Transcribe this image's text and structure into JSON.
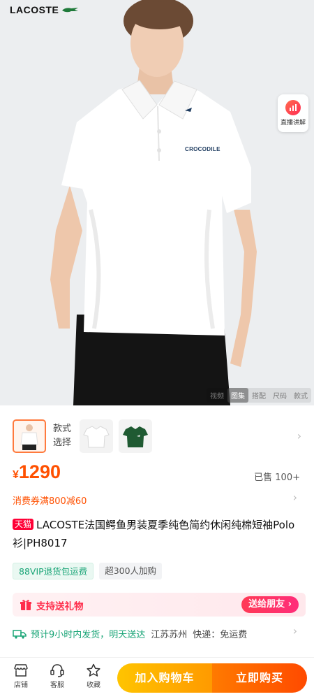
{
  "hero": {
    "brand": "LACOSTE",
    "shirt_print": "CROCODILE",
    "live_label": "直播讲解",
    "media_tabs": [
      "视频",
      "图集",
      "搭配",
      "尺码",
      "款式"
    ],
    "active_tab": "图集"
  },
  "variant": {
    "label_line1": "款式",
    "label_line2": "选择",
    "options": [
      {
        "icon": "model-white-polo-thumbnail",
        "color": "#ffffff",
        "selected": true
      },
      {
        "icon": "white-polo-thumbnail",
        "color": "#ffffff",
        "selected": false
      },
      {
        "icon": "green-polo-thumbnail",
        "color": "#1f5a32",
        "selected": false
      }
    ]
  },
  "price": {
    "currency": "¥",
    "value": "1290",
    "sold": "已售 100+"
  },
  "coupon": "消费券满800减60",
  "product": {
    "badge": "天猫",
    "title": "LACOSTE法国鳄鱼男装夏季纯色简约休闲纯棉短袖Polo衫|PH8017"
  },
  "tags": [
    "88VIP退货包运费",
    "超300人加购"
  ],
  "gift": {
    "text": "支持送礼物",
    "button": "送给朋友 ›"
  },
  "shipping": {
    "text": "预计9小时内发货，明天送达",
    "origin": "江苏苏州",
    "fee": "快递：免运费"
  },
  "bottom_bar": {
    "store": "店铺",
    "service": "客服",
    "favorite": "收藏",
    "add_to_cart": "加入购物车",
    "buy_now": "立即购买"
  },
  "colors": {
    "price": "#ff5000",
    "tmall": "#ff0036",
    "green": "#1aa577",
    "cart": "#ffb000",
    "buy": "#ff5a00"
  }
}
